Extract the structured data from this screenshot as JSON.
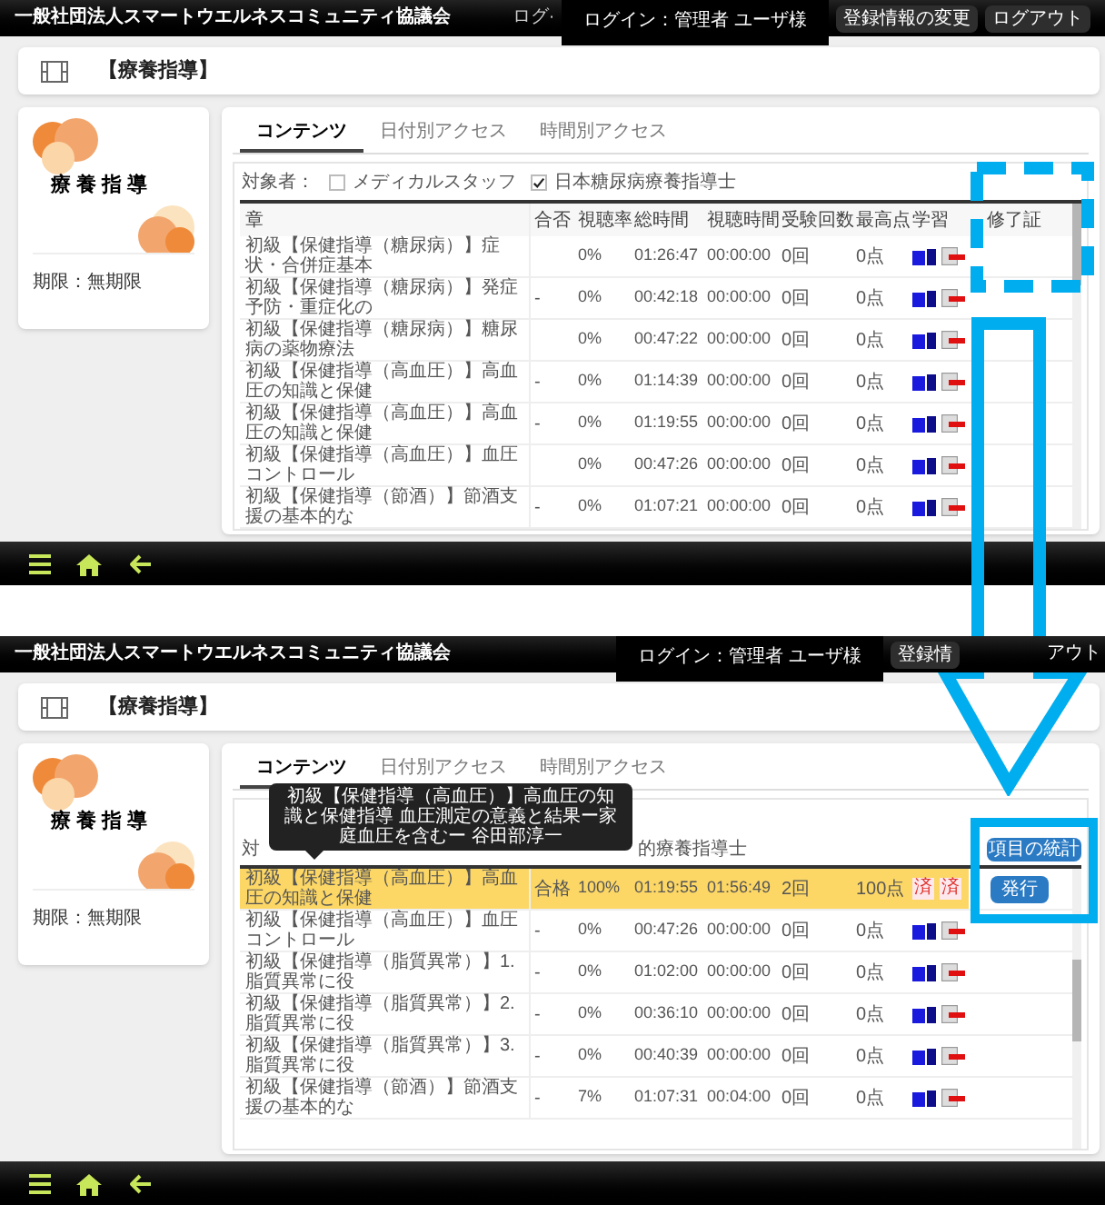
{
  "panels": [
    {
      "header": {
        "org": "一般社団法人スマートウエルネスコミュニティ協議会",
        "fragment": "ログ·",
        "login": "ログイン：管理者 ユーザ様",
        "buttons": [
          "登録情報の変更",
          "ログアウト"
        ]
      },
      "page_title": "【療養指導】",
      "course_card": {
        "logo_text": "療養指導",
        "period": "期限：無期限"
      },
      "tabs": [
        {
          "label": "コンテンツ",
          "selected": true
        },
        {
          "label": "日付別アクセス",
          "selected": false
        },
        {
          "label": "時間別アクセス",
          "selected": false
        }
      ],
      "filter": {
        "label": "対象者：",
        "options": [
          {
            "label": "メディカルスタッフ",
            "checked": false
          },
          {
            "label": "日本糖尿病療養指導士",
            "checked": true
          }
        ]
      },
      "columns": [
        "章",
        "合否",
        "視聴率",
        "総時間",
        "視聴時間",
        "受験回数",
        "最高点",
        "学習",
        "修了証"
      ],
      "rows": [
        {
          "title": "初級【保健指導（糖尿病）】症状・合併症基本",
          "rate": "0%",
          "total": "01:26:47",
          "watched": "00:00:00",
          "attempts": "0回",
          "score": "0点",
          "selected": false,
          "completed": false
        },
        {
          "title": "初級【保健指導（糖尿病）】発症予防・重症化の",
          "result": "-",
          "rate": "0%",
          "total": "00:42:18",
          "watched": "00:00:00",
          "attempts": "0回",
          "score": "0点",
          "selected": false,
          "completed": false
        },
        {
          "title": "初級【保健指導（糖尿病）】糖尿病の薬物療法",
          "rate": "0%",
          "total": "00:47:22",
          "watched": "00:00:00",
          "attempts": "0回",
          "score": "0点",
          "selected": false,
          "completed": false
        },
        {
          "title": "初級【保健指導（高血圧）】高血圧の知識と保健",
          "result": "-",
          "rate": "0%",
          "total": "01:14:39",
          "watched": "00:00:00",
          "attempts": "0回",
          "score": "0点",
          "selected": false,
          "completed": false
        },
        {
          "title": "初級【保健指導（高血圧）】高血圧の知識と保健",
          "result": "-",
          "rate": "0%",
          "total": "01:19:55",
          "watched": "00:00:00",
          "attempts": "0回",
          "score": "0点",
          "selected": false,
          "completed": false
        },
        {
          "title": "初級【保健指導（高血圧）】血圧コントロール",
          "rate": "0%",
          "total": "00:47:26",
          "watched": "00:00:00",
          "attempts": "0回",
          "score": "0点",
          "selected": false,
          "completed": false
        },
        {
          "title": "初級【保健指導（節酒）】節酒支援の基本的な",
          "result": "-",
          "rate": "0%",
          "total": "01:07:21",
          "watched": "00:00:00",
          "attempts": "0回",
          "score": "0点",
          "selected": false,
          "completed": false
        }
      ]
    },
    {
      "header": {
        "org": "一般社団法人スマートウエルネスコミュニティ協議会",
        "login": "ログイン：管理者 ユーザ様",
        "buttons": [
          "登録情",
          "アウト"
        ]
      },
      "page_title": "【療養指導】",
      "course_card": {
        "logo_text": "療養指導",
        "period": "期限：無期限"
      },
      "tabs": [
        {
          "label": "コンテンツ",
          "selected": true
        },
        {
          "label": "日付別アクセス",
          "selected": false
        },
        {
          "label": "時間別アクセス",
          "selected": false
        }
      ],
      "filter": {
        "label": "対",
        "options": [
          {
            "label": "的療養指導士"
          }
        ]
      },
      "stats_button": "項目の統計",
      "tooltip": "初級【保健指導（高血圧）】高血圧の知識と保健指導 血圧測定の意義と結果ー家庭血圧を含むー 谷田部淳一",
      "rows": [
        {
          "title": "初級【保健指導（高血圧）】高血圧の知識と保健",
          "result": "合格",
          "rate": "100%",
          "total": "01:19:55",
          "watched": "01:56:49",
          "attempts": "2回",
          "score": "100点",
          "selected": true,
          "completed": true,
          "stamps": [
            "済",
            "済"
          ],
          "certificate": "発行"
        },
        {
          "title": "初級【保健指導（高血圧）】血圧コントロール",
          "result": "-",
          "rate": "0%",
          "total": "00:47:26",
          "watched": "00:00:00",
          "attempts": "0回",
          "score": "0点",
          "selected": false,
          "completed": false
        },
        {
          "title": "初級【保健指導（脂質異常）】1. 脂質異常に役",
          "result": "-",
          "rate": "0%",
          "total": "01:02:00",
          "watched": "00:00:00",
          "attempts": "0回",
          "score": "0点",
          "selected": false,
          "completed": false
        },
        {
          "title": "初級【保健指導（脂質異常）】2. 脂質異常に役",
          "result": "-",
          "rate": "0%",
          "total": "00:36:10",
          "watched": "00:00:00",
          "attempts": "0回",
          "score": "0点",
          "selected": false,
          "completed": false
        },
        {
          "title": "初級【保健指導（脂質異常）】3. 脂質異常に役",
          "result": "-",
          "rate": "0%",
          "total": "00:40:39",
          "watched": "00:00:00",
          "attempts": "0回",
          "score": "0点",
          "selected": false,
          "completed": false
        },
        {
          "title": "初級【保健指導（節酒）】節酒支援の基本的な",
          "result": "-",
          "rate": "7%",
          "total": "01:07:31",
          "watched": "00:04:00",
          "attempts": "0回",
          "score": "0点",
          "selected": false,
          "completed": false
        }
      ]
    }
  ]
}
